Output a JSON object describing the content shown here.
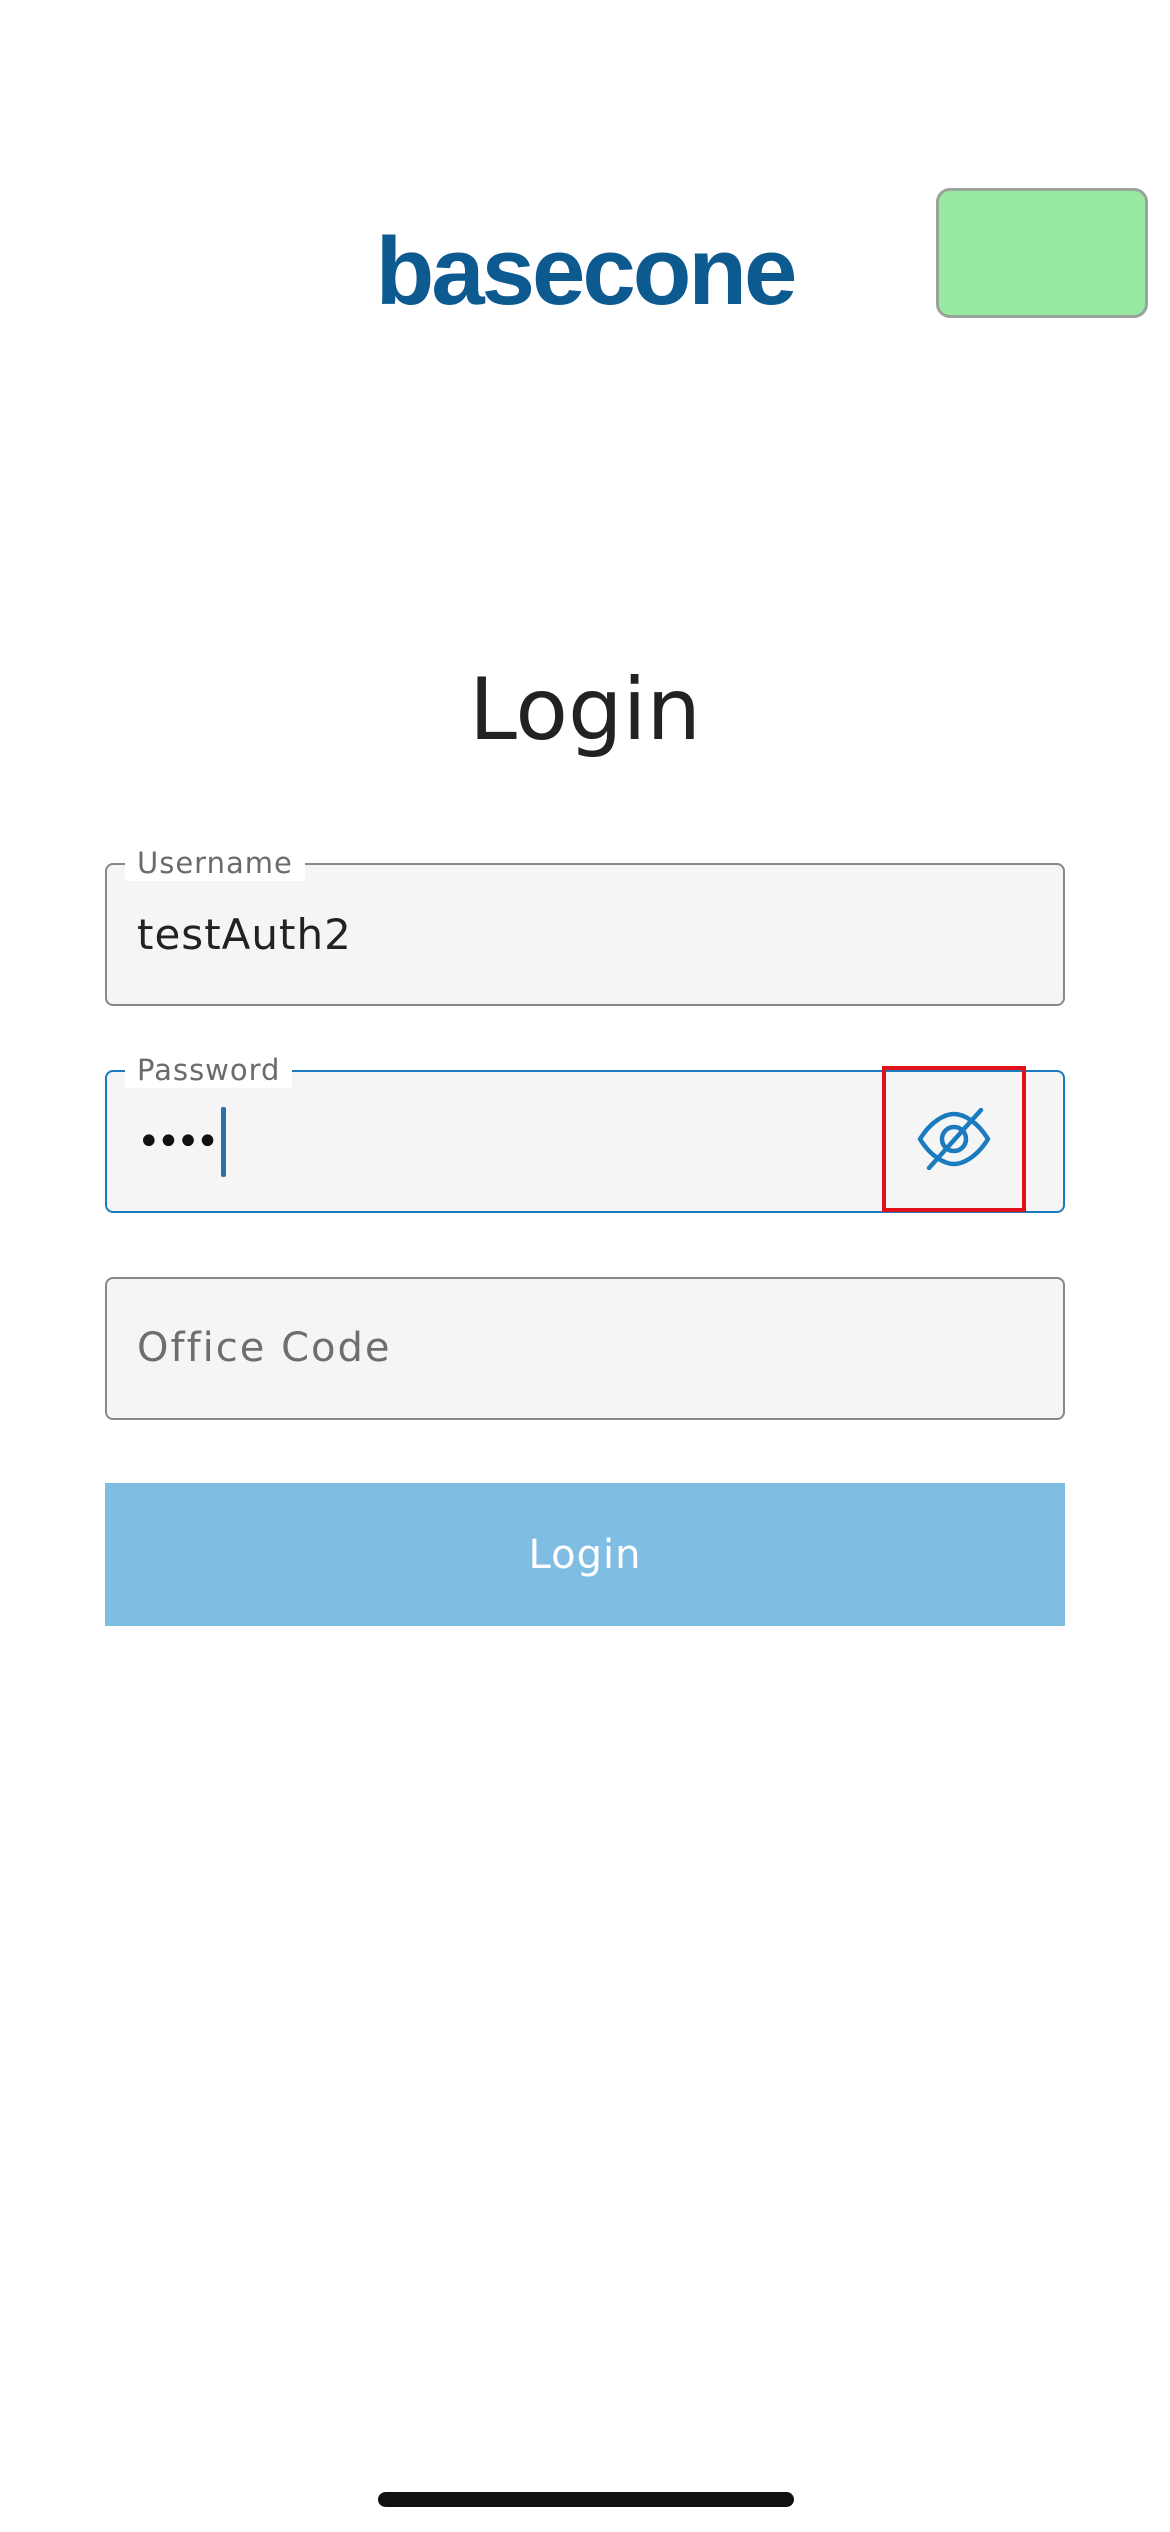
{
  "header": {
    "logo_text": "basecone"
  },
  "login": {
    "title": "Login",
    "username": {
      "label": "Username",
      "value": "testAuth2"
    },
    "password": {
      "label": "Password",
      "masked_value": "••••",
      "toggle_icon": "eye-slash-icon"
    },
    "office_code": {
      "placeholder": "Office Code"
    },
    "submit_label": "Login"
  },
  "colors": {
    "brand": "#0d5a91",
    "accent": "#1a7bbf",
    "button_disabled": "#80bde3",
    "highlight": "#e0111b",
    "green_box": "#98e9a1"
  }
}
